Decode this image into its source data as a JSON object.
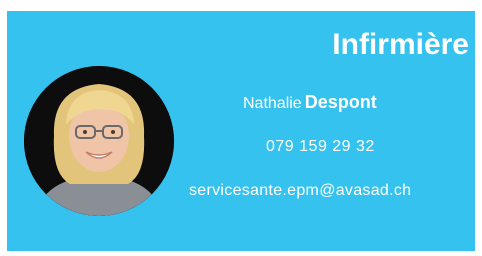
{
  "contact": {
    "title": "Infirmière",
    "first_name": "Nathalie",
    "last_name": "Despont",
    "phone": "079 159 29 32",
    "email": "servicesante.epm@avasad.ch"
  },
  "colors": {
    "card_background": "#35c2ee",
    "text": "#ffffff",
    "avatar_background": "#0d0d0d"
  },
  "icons": {
    "avatar": "portrait-photo"
  }
}
